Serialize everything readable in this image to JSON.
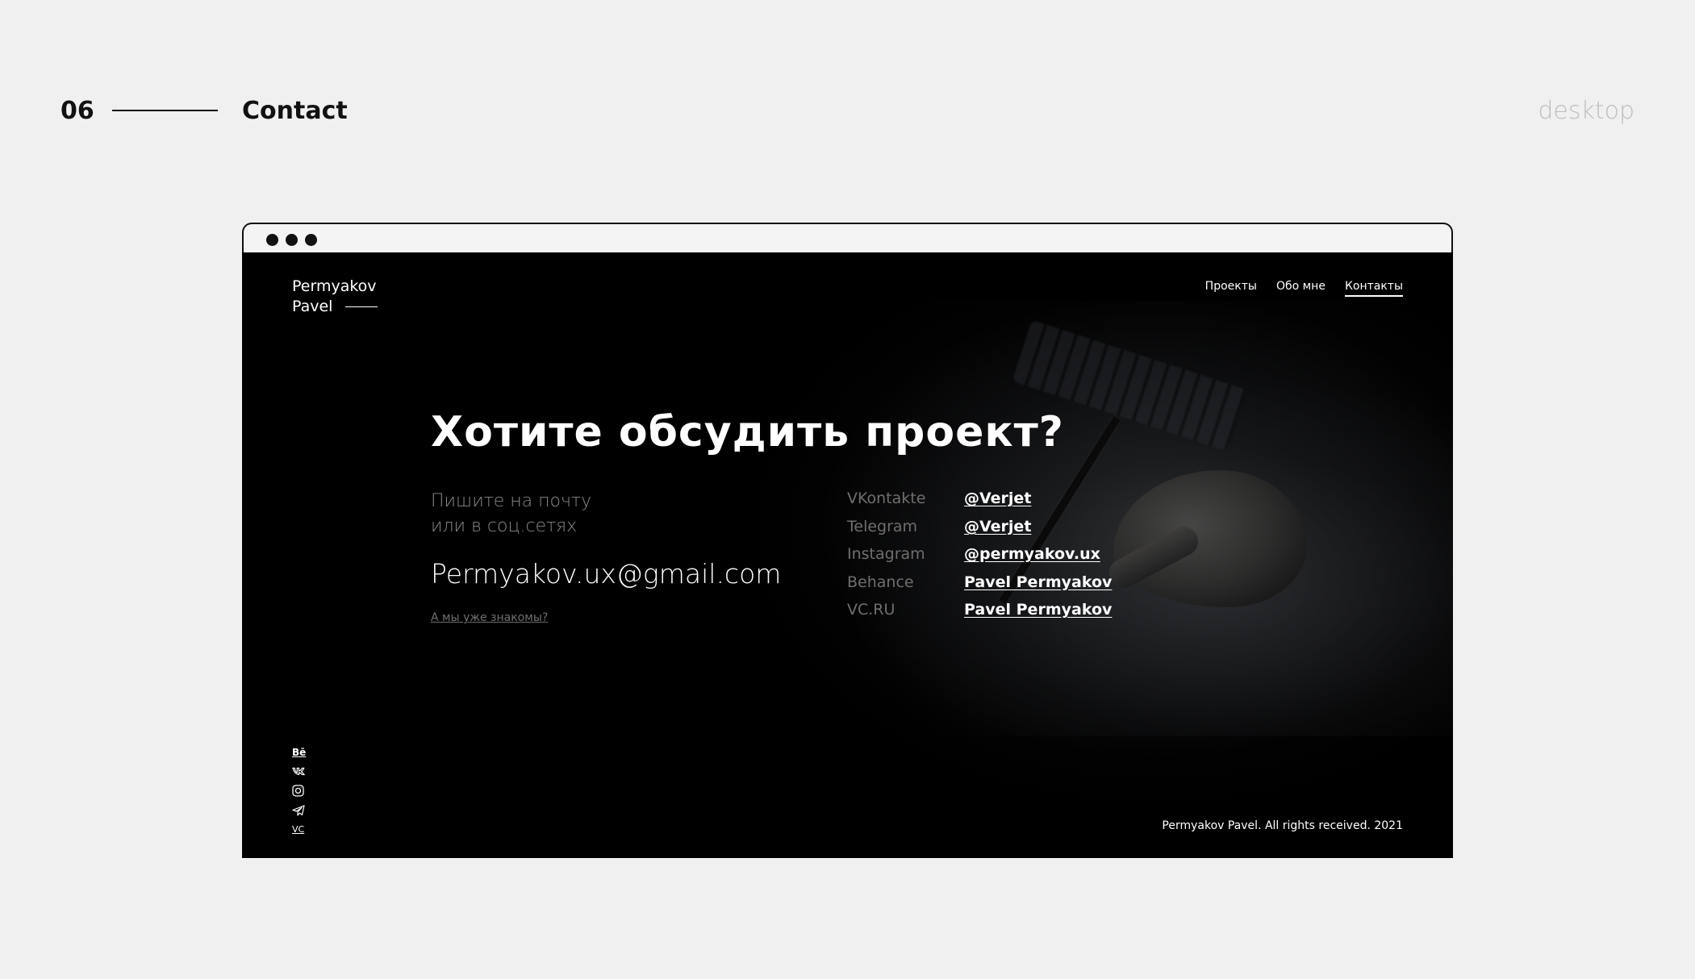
{
  "slide": {
    "number": "06",
    "title": "Contact",
    "device": "desktop"
  },
  "site": {
    "logo_line1": "Permyakov",
    "logo_line2": "Pavel",
    "nav": [
      {
        "label": "Проекты"
      },
      {
        "label": "Обо мне"
      },
      {
        "label": "Контакты",
        "active": true
      }
    ],
    "headline": "Хотите обсудить проект?",
    "subtitle_line1": "Пишите на почту",
    "subtitle_line2": "или в соц.сетях",
    "email": "Permyakov.ux@gmail.com",
    "known_link": "А мы уже знакомы?",
    "contacts": [
      {
        "label": "VKontakte",
        "value": "@Verjet"
      },
      {
        "label": "Telegram",
        "value": "@Verjet"
      },
      {
        "label": "Instagram",
        "value": "@permyakov.ux"
      },
      {
        "label": "Behance",
        "value": "Pavel Permyakov"
      },
      {
        "label": "VC.RU",
        "value": "Pavel Permyakov"
      }
    ],
    "social": [
      {
        "icon": "behance-icon",
        "text": "Bē"
      },
      {
        "icon": "vk-icon"
      },
      {
        "icon": "instagram-icon"
      },
      {
        "icon": "telegram-icon"
      },
      {
        "icon": "vc-icon",
        "text": "VC"
      }
    ],
    "copyright": "Permyakov Pavel. All rights received. 2021"
  },
  "colors": {
    "page_bg": "#f0f0f0",
    "site_bg": "#000000",
    "text_primary": "#ffffff",
    "text_muted": "#6f6f6f",
    "device_label": "#bdbdbd"
  }
}
